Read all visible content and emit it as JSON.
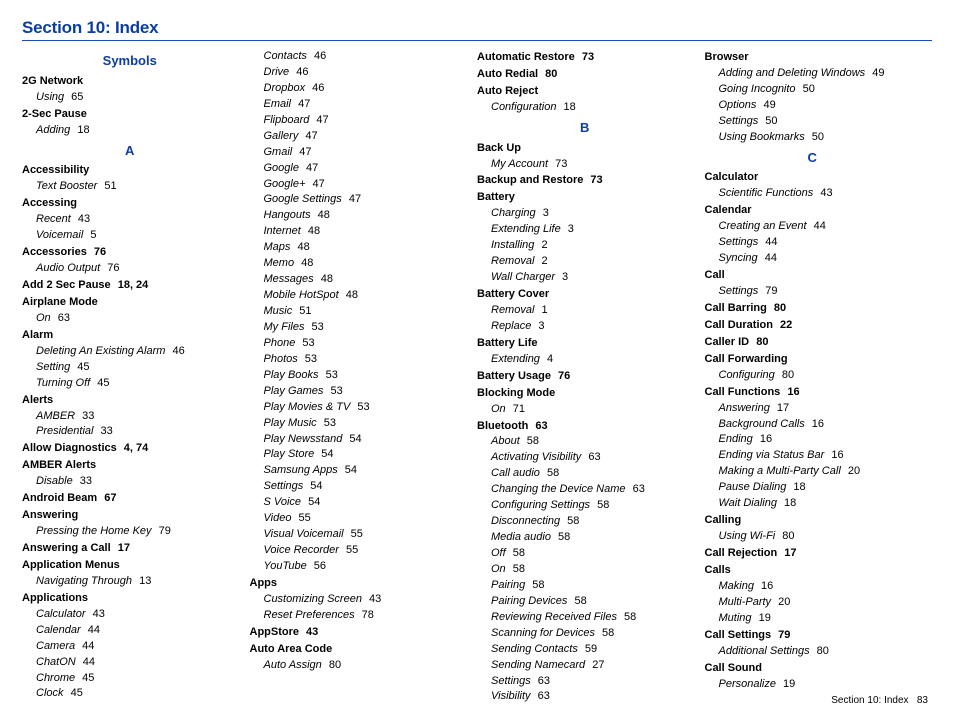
{
  "header": {
    "title": "Section 10: Index"
  },
  "footer": {
    "label": "Section 10:  Index",
    "page": "83"
  },
  "columns": [
    [
      {
        "type": "letter",
        "text": "Symbols"
      },
      {
        "type": "entry",
        "text": "2G Network"
      },
      {
        "type": "sub",
        "text": "Using",
        "page": "65"
      },
      {
        "type": "entry",
        "text": "2-Sec Pause"
      },
      {
        "type": "sub",
        "text": "Adding",
        "page": "18"
      },
      {
        "type": "letter",
        "text": "A"
      },
      {
        "type": "entry",
        "text": "Accessibility"
      },
      {
        "type": "sub",
        "text": "Text Booster",
        "page": "51"
      },
      {
        "type": "entry",
        "text": "Accessing"
      },
      {
        "type": "sub",
        "text": "Recent",
        "page": "43"
      },
      {
        "type": "sub",
        "text": "Voicemail",
        "page": "5"
      },
      {
        "type": "entry",
        "text": "Accessories",
        "page": "76"
      },
      {
        "type": "sub",
        "text": "Audio Output",
        "page": "76"
      },
      {
        "type": "entry",
        "text": "Add 2 Sec Pause",
        "page": "18, 24"
      },
      {
        "type": "entry",
        "text": "Airplane Mode"
      },
      {
        "type": "sub",
        "text": "On",
        "page": "63"
      },
      {
        "type": "entry",
        "text": "Alarm"
      },
      {
        "type": "sub",
        "text": "Deleting An Existing Alarm",
        "page": "46"
      },
      {
        "type": "sub",
        "text": "Setting",
        "page": "45"
      },
      {
        "type": "sub",
        "text": "Turning Off",
        "page": "45"
      },
      {
        "type": "entry",
        "text": "Alerts"
      },
      {
        "type": "sub",
        "text": "AMBER",
        "page": "33"
      },
      {
        "type": "sub",
        "text": "Presidential",
        "page": "33"
      },
      {
        "type": "entry",
        "text": "Allow Diagnostics",
        "page": "4, 74"
      },
      {
        "type": "entry",
        "text": "AMBER Alerts"
      },
      {
        "type": "sub",
        "text": "Disable",
        "page": "33"
      },
      {
        "type": "entry",
        "text": "Android Beam",
        "page": "67"
      },
      {
        "type": "entry",
        "text": "Answering"
      },
      {
        "type": "sub",
        "text": "Pressing the Home Key",
        "page": "79"
      },
      {
        "type": "entry",
        "text": "Answering a Call",
        "page": "17"
      },
      {
        "type": "entry",
        "text": "Application Menus"
      },
      {
        "type": "sub",
        "text": "Navigating Through",
        "page": "13"
      },
      {
        "type": "entry",
        "text": "Applications"
      },
      {
        "type": "sub",
        "text": "Calculator",
        "page": "43"
      },
      {
        "type": "sub",
        "text": "Calendar",
        "page": "44"
      },
      {
        "type": "sub",
        "text": "Camera",
        "page": "44"
      },
      {
        "type": "sub",
        "text": "ChatON",
        "page": "44"
      },
      {
        "type": "sub",
        "text": "Chrome",
        "page": "45"
      },
      {
        "type": "sub",
        "text": "Clock",
        "page": "45"
      }
    ],
    [
      {
        "type": "sub",
        "text": "Contacts",
        "page": "46"
      },
      {
        "type": "sub",
        "text": "Drive",
        "page": "46"
      },
      {
        "type": "sub",
        "text": "Dropbox",
        "page": "46"
      },
      {
        "type": "sub",
        "text": "Email",
        "page": "47"
      },
      {
        "type": "sub",
        "text": "Flipboard",
        "page": "47"
      },
      {
        "type": "sub",
        "text": "Gallery",
        "page": "47"
      },
      {
        "type": "sub",
        "text": "Gmail",
        "page": "47"
      },
      {
        "type": "sub",
        "text": "Google",
        "page": "47"
      },
      {
        "type": "sub",
        "text": "Google+",
        "page": "47"
      },
      {
        "type": "sub",
        "text": "Google Settings",
        "page": "47"
      },
      {
        "type": "sub",
        "text": "Hangouts",
        "page": "48"
      },
      {
        "type": "sub",
        "text": "Internet",
        "page": "48"
      },
      {
        "type": "sub",
        "text": "Maps",
        "page": "48"
      },
      {
        "type": "sub",
        "text": "Memo",
        "page": "48"
      },
      {
        "type": "sub",
        "text": "Messages",
        "page": "48"
      },
      {
        "type": "sub",
        "text": "Mobile HotSpot",
        "page": "48"
      },
      {
        "type": "sub",
        "text": "Music",
        "page": "51"
      },
      {
        "type": "sub",
        "text": "My Files",
        "page": "53"
      },
      {
        "type": "sub",
        "text": "Phone",
        "page": "53"
      },
      {
        "type": "sub",
        "text": "Photos",
        "page": "53"
      },
      {
        "type": "sub",
        "text": "Play Books",
        "page": "53"
      },
      {
        "type": "sub",
        "text": "Play Games",
        "page": "53"
      },
      {
        "type": "sub",
        "text": "Play Movies & TV",
        "page": "53"
      },
      {
        "type": "sub",
        "text": "Play Music",
        "page": "53"
      },
      {
        "type": "sub",
        "text": "Play Newsstand",
        "page": "54"
      },
      {
        "type": "sub",
        "text": "Play Store",
        "page": "54"
      },
      {
        "type": "sub",
        "text": "Samsung Apps",
        "page": "54"
      },
      {
        "type": "sub",
        "text": "Settings",
        "page": "54"
      },
      {
        "type": "sub",
        "text": "S Voice",
        "page": "54"
      },
      {
        "type": "sub",
        "text": "Video",
        "page": "55"
      },
      {
        "type": "sub",
        "text": "Visual Voicemail",
        "page": "55"
      },
      {
        "type": "sub",
        "text": "Voice Recorder",
        "page": "55"
      },
      {
        "type": "sub",
        "text": "YouTube",
        "page": "56"
      },
      {
        "type": "entry",
        "text": "Apps"
      },
      {
        "type": "sub",
        "text": "Customizing Screen",
        "page": "43"
      },
      {
        "type": "sub",
        "text": "Reset Preferences",
        "page": "78"
      },
      {
        "type": "entry",
        "text": "AppStore",
        "page": "43"
      },
      {
        "type": "entry",
        "text": "Auto Area Code"
      },
      {
        "type": "sub",
        "text": "Auto Assign",
        "page": "80"
      }
    ],
    [
      {
        "type": "entry",
        "text": "Automatic Restore",
        "page": "73"
      },
      {
        "type": "entry",
        "text": "Auto Redial",
        "page": "80"
      },
      {
        "type": "entry",
        "text": "Auto Reject"
      },
      {
        "type": "sub",
        "text": "Configuration",
        "page": "18"
      },
      {
        "type": "letter",
        "text": "B"
      },
      {
        "type": "entry",
        "text": "Back Up"
      },
      {
        "type": "sub",
        "text": "My Account",
        "page": "73"
      },
      {
        "type": "entry",
        "text": "Backup and Restore",
        "page": "73"
      },
      {
        "type": "entry",
        "text": "Battery"
      },
      {
        "type": "sub",
        "text": "Charging",
        "page": "3"
      },
      {
        "type": "sub",
        "text": "Extending Life",
        "page": "3"
      },
      {
        "type": "sub",
        "text": "Installing",
        "page": "2"
      },
      {
        "type": "sub",
        "text": "Removal",
        "page": "2"
      },
      {
        "type": "sub",
        "text": "Wall Charger",
        "page": "3"
      },
      {
        "type": "entry",
        "text": "Battery Cover"
      },
      {
        "type": "sub",
        "text": "Removal",
        "page": "1"
      },
      {
        "type": "sub",
        "text": "Replace",
        "page": "3"
      },
      {
        "type": "entry",
        "text": "Battery Life"
      },
      {
        "type": "sub",
        "text": "Extending",
        "page": "4"
      },
      {
        "type": "entry",
        "text": "Battery Usage",
        "page": "76"
      },
      {
        "type": "entry",
        "text": "Blocking Mode"
      },
      {
        "type": "sub",
        "text": "On",
        "page": "71"
      },
      {
        "type": "entry",
        "text": "Bluetooth",
        "page": "63"
      },
      {
        "type": "sub",
        "text": "About",
        "page": "58"
      },
      {
        "type": "sub",
        "text": "Activating Visibility",
        "page": "63"
      },
      {
        "type": "sub",
        "text": "Call audio",
        "page": "58"
      },
      {
        "type": "sub",
        "text": "Changing the Device Name",
        "page": "63"
      },
      {
        "type": "sub",
        "text": "Configuring Settings",
        "page": "58"
      },
      {
        "type": "sub",
        "text": "Disconnecting",
        "page": "58"
      },
      {
        "type": "sub",
        "text": "Media audio",
        "page": "58"
      },
      {
        "type": "sub",
        "text": "Off",
        "page": "58"
      },
      {
        "type": "sub",
        "text": "On",
        "page": "58"
      },
      {
        "type": "sub",
        "text": "Pairing",
        "page": "58"
      },
      {
        "type": "sub",
        "text": "Pairing Devices",
        "page": "58"
      },
      {
        "type": "sub",
        "text": "Reviewing Received Files",
        "page": "58"
      },
      {
        "type": "sub",
        "text": "Scanning for Devices",
        "page": "58"
      },
      {
        "type": "sub",
        "text": "Sending Contacts",
        "page": "59"
      },
      {
        "type": "sub",
        "text": "Sending Namecard",
        "page": "27"
      },
      {
        "type": "sub",
        "text": "Settings",
        "page": "63"
      },
      {
        "type": "sub",
        "text": "Visibility",
        "page": "63"
      }
    ],
    [
      {
        "type": "entry",
        "text": "Browser"
      },
      {
        "type": "sub",
        "text": "Adding and Deleting Windows",
        "page": "49"
      },
      {
        "type": "sub",
        "text": "Going Incognito",
        "page": "50"
      },
      {
        "type": "sub",
        "text": "Options",
        "page": "49"
      },
      {
        "type": "sub",
        "text": "Settings",
        "page": "50"
      },
      {
        "type": "sub",
        "text": "Using Bookmarks",
        "page": "50"
      },
      {
        "type": "letter",
        "text": "C"
      },
      {
        "type": "entry",
        "text": "Calculator"
      },
      {
        "type": "sub",
        "text": "Scientific Functions",
        "page": "43"
      },
      {
        "type": "entry",
        "text": "Calendar"
      },
      {
        "type": "sub",
        "text": "Creating an Event",
        "page": "44"
      },
      {
        "type": "sub",
        "text": "Settings",
        "page": "44"
      },
      {
        "type": "sub",
        "text": "Syncing",
        "page": "44"
      },
      {
        "type": "entry",
        "text": "Call"
      },
      {
        "type": "sub",
        "text": "Settings",
        "page": "79"
      },
      {
        "type": "entry",
        "text": "Call Barring",
        "page": "80"
      },
      {
        "type": "entry",
        "text": "Call Duration",
        "page": "22"
      },
      {
        "type": "entry",
        "text": "Caller ID",
        "page": "80"
      },
      {
        "type": "entry",
        "text": "Call Forwarding"
      },
      {
        "type": "sub",
        "text": "Configuring",
        "page": "80"
      },
      {
        "type": "entry",
        "text": "Call Functions",
        "page": "16"
      },
      {
        "type": "sub",
        "text": "Answering",
        "page": "17"
      },
      {
        "type": "sub",
        "text": "Background Calls",
        "page": "16"
      },
      {
        "type": "sub",
        "text": "Ending",
        "page": "16"
      },
      {
        "type": "sub",
        "text": "Ending via Status Bar",
        "page": "16"
      },
      {
        "type": "sub",
        "text": "Making a Multi-Party Call",
        "page": "20"
      },
      {
        "type": "sub",
        "text": "Pause Dialing",
        "page": "18"
      },
      {
        "type": "sub",
        "text": "Wait Dialing",
        "page": "18"
      },
      {
        "type": "entry",
        "text": "Calling"
      },
      {
        "type": "sub",
        "text": "Using Wi-Fi",
        "page": "80"
      },
      {
        "type": "entry",
        "text": "Call Rejection",
        "page": "17"
      },
      {
        "type": "entry",
        "text": "Calls"
      },
      {
        "type": "sub",
        "text": "Making",
        "page": "16"
      },
      {
        "type": "sub",
        "text": "Multi-Party",
        "page": "20"
      },
      {
        "type": "sub",
        "text": "Muting",
        "page": "19"
      },
      {
        "type": "entry",
        "text": "Call Settings",
        "page": "79"
      },
      {
        "type": "sub",
        "text": "Additional Settings",
        "page": "80"
      },
      {
        "type": "entry",
        "text": "Call Sound"
      },
      {
        "type": "sub",
        "text": "Personalize",
        "page": "19"
      }
    ]
  ]
}
